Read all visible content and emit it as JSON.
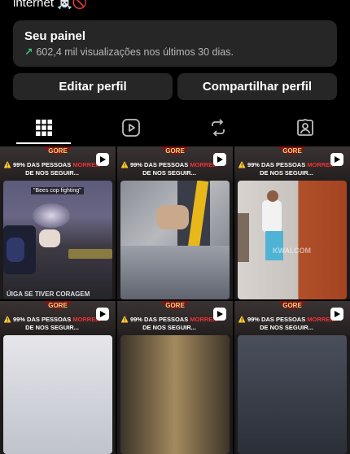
{
  "profile": {
    "bio_line": "internet ☠️🚫"
  },
  "dashboard": {
    "title": "Seu painel",
    "arrow": "↗",
    "stats": "602,4 mil visualizações nos últimos 30 dias."
  },
  "buttons": {
    "edit_profile": "Editar perfil",
    "share_profile": "Compartilhar perfil"
  },
  "tabs": [
    {
      "name": "grid",
      "icon": "grid-icon",
      "active": true
    },
    {
      "name": "reels",
      "icon": "reels-icon",
      "active": false
    },
    {
      "name": "reposts",
      "icon": "repost-icon",
      "active": false
    },
    {
      "name": "tagged",
      "icon": "tagged-icon",
      "active": false
    }
  ],
  "posts": [
    {
      "logo": "GORE",
      "caption_prefix": "⚠️ 99% DAS PESSOAS ",
      "caption_highlight": "MORREM",
      "caption_suffix": " DE NOS SEGUIR...",
      "overlay": "\"Bees cop fighting\"",
      "bottom": "ÚIGA SE TIVER CORAGEM"
    },
    {
      "logo": "GORE",
      "caption_prefix": "⚠️ 99% DAS PESSOAS ",
      "caption_highlight": "MORREM",
      "caption_suffix": " DE NOS SEGUIR..."
    },
    {
      "logo": "GORE",
      "caption_prefix": "⚠️ 99% DAS PESSOAS ",
      "caption_highlight": "MORREM",
      "caption_suffix": " DE NOS SEGUIR...",
      "watermark": "KWAI.COM"
    },
    {
      "logo": "GORE",
      "caption_prefix": "⚠️ 99% DAS PESSOAS ",
      "caption_highlight": "MORREM",
      "caption_suffix": " DE NOS SEGUIR..."
    },
    {
      "logo": "GORE",
      "caption_prefix": "⚠️ 99% DAS PESSOAS ",
      "caption_highlight": "MORREM",
      "caption_suffix": " DE NOS SEGUIR..."
    },
    {
      "logo": "GORE",
      "caption_prefix": "⚠️ 99% DAS PESSOAS ",
      "caption_highlight": "MORREM",
      "caption_suffix": " DE NOS SEGUIR..."
    }
  ],
  "colors": {
    "background": "#000000",
    "card": "#262626",
    "accent_green": "#3ac274"
  }
}
